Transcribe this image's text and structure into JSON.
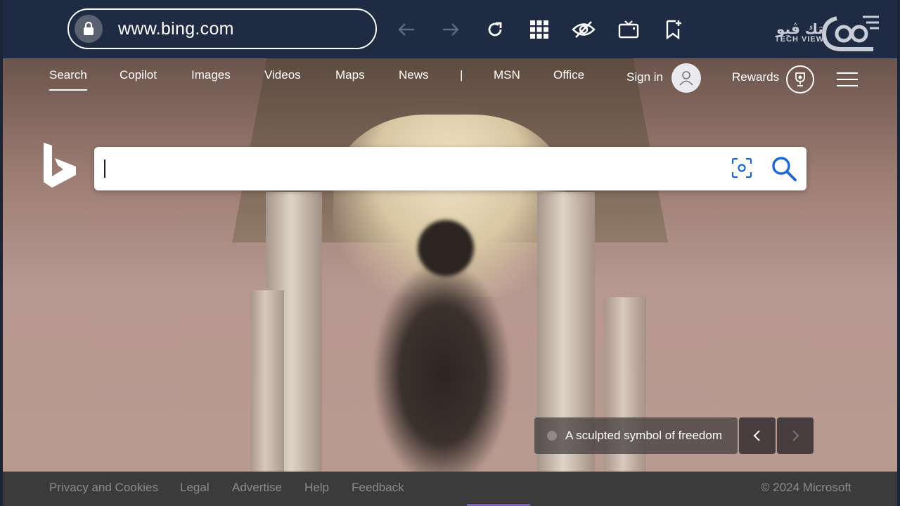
{
  "browser": {
    "url": "www.bing.com",
    "watermark": "TECH VIEW"
  },
  "nav": {
    "items": [
      {
        "label": "Search",
        "active": true
      },
      {
        "label": "Copilot"
      },
      {
        "label": "Images"
      },
      {
        "label": "Videos"
      },
      {
        "label": "Maps"
      },
      {
        "label": "News"
      },
      {
        "label": "|"
      },
      {
        "label": "MSN"
      },
      {
        "label": "Office"
      }
    ],
    "sign_in": "Sign in",
    "rewards": "Rewards"
  },
  "search": {
    "value": ""
  },
  "caption": {
    "text": "A sculpted symbol of freedom"
  },
  "footer": {
    "links": [
      "Privacy and Cookies",
      "Legal",
      "Advertise",
      "Help",
      "Feedback"
    ],
    "copyright": "© 2024 Microsoft"
  },
  "colors": {
    "toolbar": "#1f2b42",
    "search_accent": "#1967d2",
    "footer": "#3b3b3b"
  }
}
